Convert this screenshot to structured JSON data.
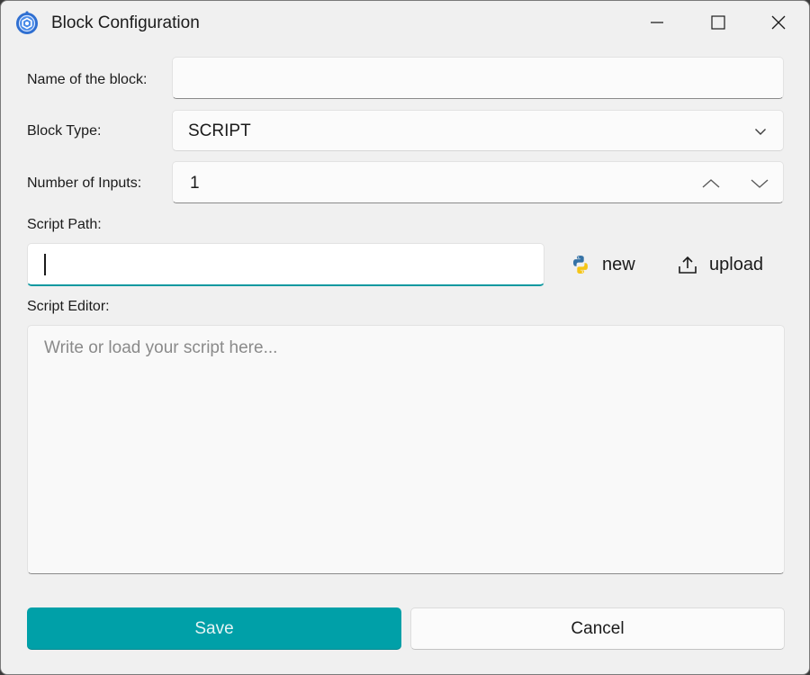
{
  "window": {
    "title": "Block Configuration"
  },
  "form": {
    "name_label": "Name of the block:",
    "name_value": "",
    "type_label": "Block Type:",
    "type_value": "SCRIPT",
    "inputs_label": "Number of Inputs:",
    "inputs_value": "1",
    "path_label": "Script Path:",
    "path_value": "",
    "new_label": "new",
    "upload_label": "upload",
    "editor_label": "Script Editor:",
    "editor_placeholder": "Write or load your script here..."
  },
  "actions": {
    "save_label": "Save",
    "cancel_label": "Cancel"
  },
  "colors": {
    "accent": "#00a0a8",
    "background": "#f0f0f0"
  }
}
